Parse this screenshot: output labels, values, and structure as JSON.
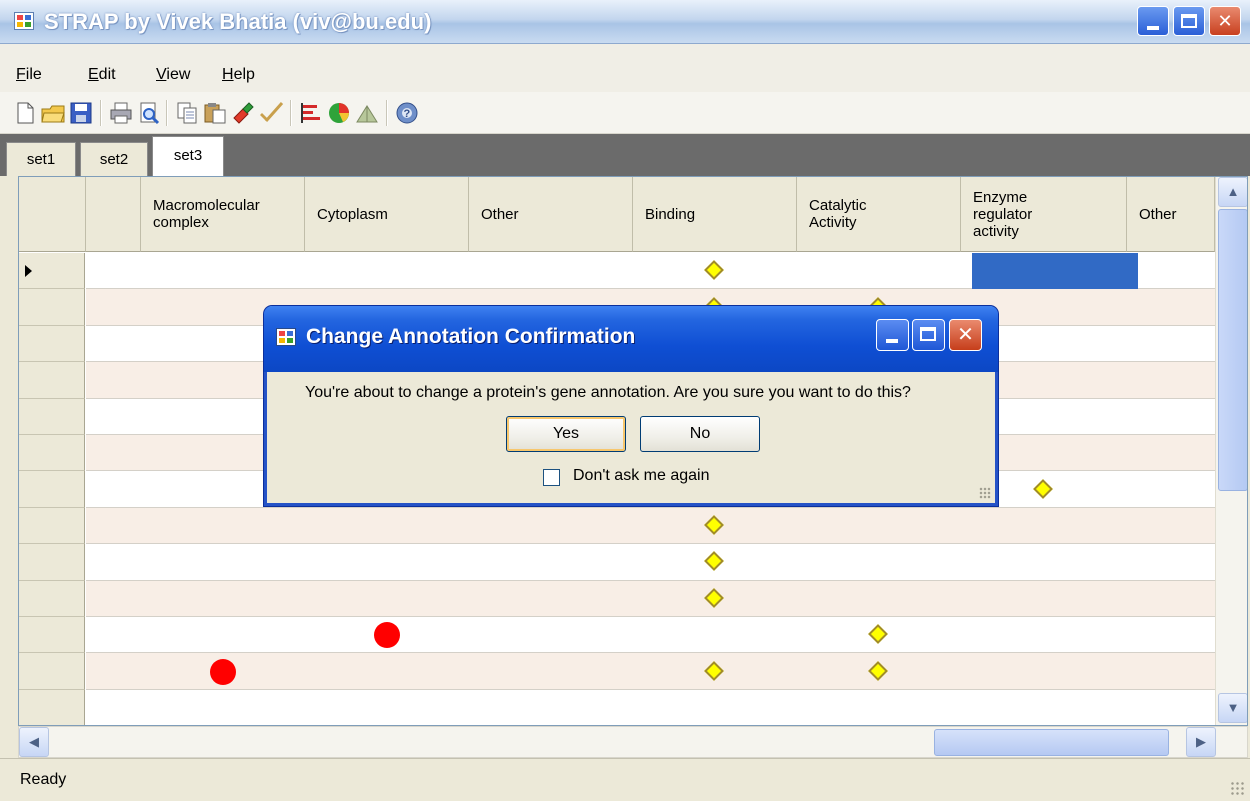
{
  "window": {
    "title": "STRAP by Vivek Bhatia (viv@bu.edu)"
  },
  "menu": [
    {
      "label": "File",
      "mnemonic": "F",
      "rest": "ile"
    },
    {
      "label": "Edit",
      "mnemonic": "E",
      "rest": "dit"
    },
    {
      "label": "View",
      "mnemonic": "V",
      "rest": "iew"
    },
    {
      "label": "Help",
      "mnemonic": "H",
      "rest": "elp"
    }
  ],
  "toolbar": {
    "icons": [
      "new-icon",
      "open-icon",
      "save-icon",
      "print-icon",
      "print-preview-icon",
      "copy-icon",
      "paste-icon",
      "paint-icon",
      "check-icon",
      "bar-chart-icon",
      "pie-chart-icon",
      "broom-icon",
      "help-icon"
    ]
  },
  "tabs": [
    {
      "label": "set1",
      "active": false
    },
    {
      "label": "set2",
      "active": false
    },
    {
      "label": "set3",
      "active": true
    }
  ],
  "grid": {
    "columns": [
      "",
      "Macromolecular complex",
      "Cytoplasm",
      "Other",
      "Binding",
      "Catalytic Activity",
      "Enzyme regulator activity",
      "Other"
    ],
    "column_lines": [
      [],
      [
        "Macromolecular",
        "complex"
      ],
      [
        "Cytoplasm"
      ],
      [
        "Other"
      ],
      [
        "Binding"
      ],
      [
        "Catalytic",
        "Activity"
      ],
      [
        "Enzyme",
        "regulator",
        "activity"
      ],
      [
        "Other"
      ]
    ],
    "row_count": 13,
    "current_row": 0,
    "selected_cell": {
      "row": 0,
      "column": "Enzyme regulator activity"
    },
    "diamond_marks": [
      {
        "row": 0,
        "column": "Binding"
      },
      {
        "row": 1,
        "column": "Binding"
      },
      {
        "row": 1,
        "column": "Catalytic Activity"
      },
      {
        "row": 6,
        "column": "Enzyme regulator activity"
      },
      {
        "row": 7,
        "column": "Binding"
      },
      {
        "row": 8,
        "column": "Binding"
      },
      {
        "row": 9,
        "column": "Binding"
      },
      {
        "row": 10,
        "column": "Catalytic Activity"
      },
      {
        "row": 11,
        "column": "Binding"
      },
      {
        "row": 11,
        "column": "Catalytic Activity"
      }
    ],
    "dot_marks": [
      {
        "row": 10,
        "column": "Cytoplasm"
      },
      {
        "row": 11,
        "column": "Macromolecular complex"
      }
    ],
    "colors": {
      "alt_row": "#f8eee6",
      "selection": "#316ac5",
      "diamond": "#ffff00",
      "dot": "#ff0000"
    }
  },
  "dialog": {
    "title": "Change Annotation Confirmation",
    "message": "You're about to change a protein's gene annotation. Are you sure you want to do this?",
    "yes_label": "Yes",
    "no_label": "No",
    "checkbox_label": "Don't ask me again",
    "checkbox_checked": false
  },
  "status": {
    "text": "Ready"
  }
}
